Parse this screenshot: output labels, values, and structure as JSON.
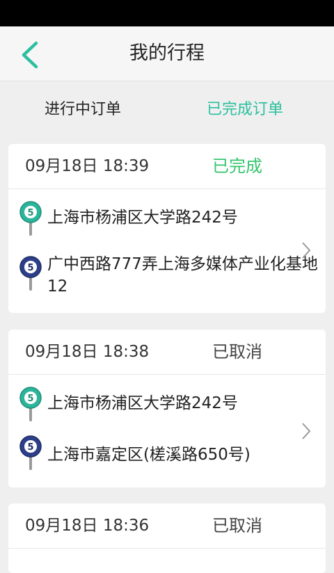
{
  "header": {
    "title": "我的行程"
  },
  "tabs": [
    {
      "label": "进行中订单"
    },
    {
      "label": "已完成订单"
    }
  ],
  "orders": [
    {
      "time": "09月18日 18:39",
      "status": "已完成",
      "from": "上海市杨浦区大学路242号",
      "to": "广中西路777弄上海多媒体产业化基地12"
    },
    {
      "time": "09月18日 18:38",
      "status": "已取消",
      "from": "上海市杨浦区大学路242号",
      "to": "上海市嘉定区(槎溪路650号)"
    },
    {
      "time": "09月18日 18:36",
      "status": "已取消"
    }
  ],
  "colors": {
    "accent": "#2bbf9e",
    "status_done": "#35c46e",
    "pin_start": "#2bb59a",
    "pin_end": "#2e3f8a"
  },
  "icons": {
    "back": "chevron-left-icon",
    "start_pin": "start-pin-icon",
    "end_pin": "end-pin-icon",
    "row_arrow": "chevron-right-icon"
  }
}
